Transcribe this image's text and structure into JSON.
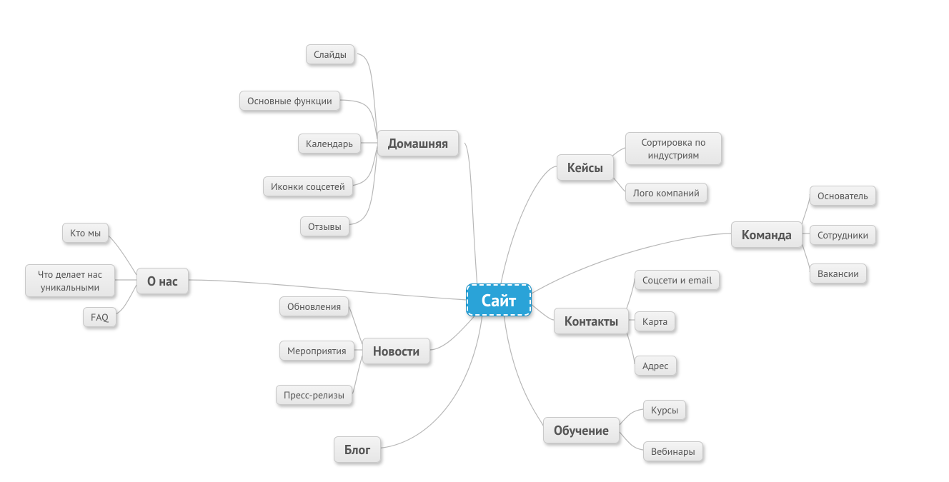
{
  "root": {
    "label": "Сайт"
  },
  "branches": {
    "home": {
      "label": "Домашняя",
      "children": [
        "Слайды",
        "Основные функции",
        "Календарь",
        "Иконки соцсетей",
        "Отзывы"
      ]
    },
    "about": {
      "label": "О нас",
      "children": [
        "Кто мы",
        "Что делает нас\nуникальными",
        "FAQ"
      ]
    },
    "news": {
      "label": "Новости",
      "children": [
        "Обновления",
        "Мероприятия",
        "Пресс-релизы"
      ]
    },
    "blog": {
      "label": "Блог",
      "children": []
    },
    "cases": {
      "label": "Кейсы",
      "children": [
        "Сортировка по\nиндустриям",
        "Лого компаний"
      ]
    },
    "team": {
      "label": "Команда",
      "children": [
        "Основатель",
        "Сотрудники",
        "Вакансии"
      ]
    },
    "contacts": {
      "label": "Контакты",
      "children": [
        "Соцсети и email",
        "Карта",
        "Адрес"
      ]
    },
    "learn": {
      "label": "Обучение",
      "children": [
        "Курсы",
        "Вебинары"
      ]
    }
  }
}
